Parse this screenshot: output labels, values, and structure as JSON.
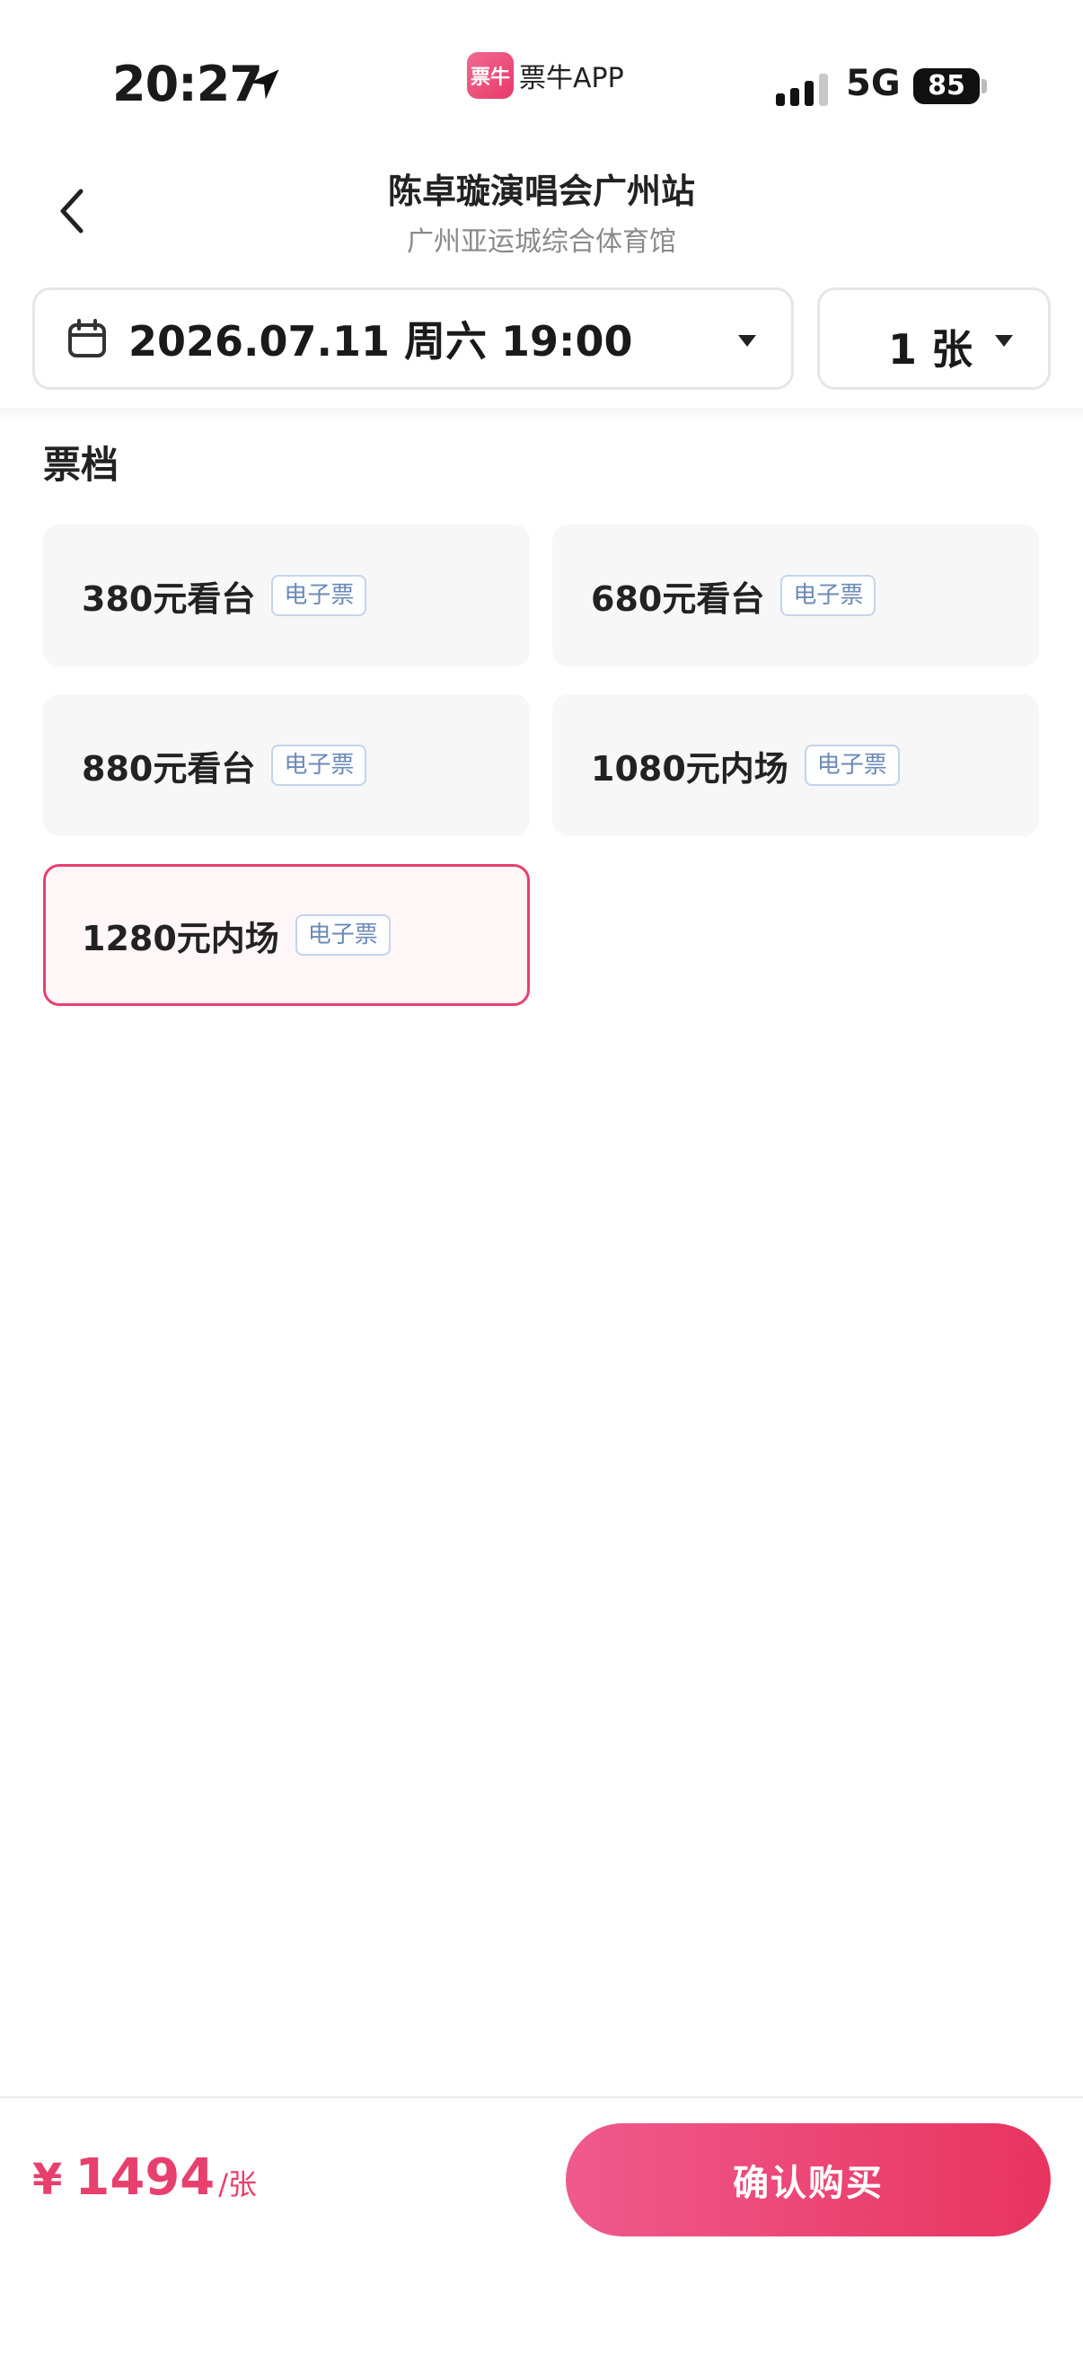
{
  "status_bar": {
    "time": "20:27",
    "app_name": "票牛APP",
    "app_logo_text": "票牛",
    "network": "5G",
    "battery": "85"
  },
  "header": {
    "title": "陈卓璇演唱会广州站",
    "subtitle": "广州亚运城综合体育馆"
  },
  "date_selector": {
    "value": "2026.07.11 周六 19:00"
  },
  "quantity_selector": {
    "value": "1 张"
  },
  "section": {
    "title": "票档"
  },
  "tiers": [
    {
      "label": "380元看台",
      "tag": "电子票",
      "selected": false
    },
    {
      "label": "680元看台",
      "tag": "电子票",
      "selected": false
    },
    {
      "label": "880元看台",
      "tag": "电子票",
      "selected": false
    },
    {
      "label": "1080元内场",
      "tag": "电子票",
      "selected": false
    },
    {
      "label": "1280元内场",
      "tag": "电子票",
      "selected": true
    }
  ],
  "bottom_bar": {
    "currency": "¥",
    "price": "1494",
    "unit": "/张",
    "buy_label": "确认购买"
  },
  "colors": {
    "accent": "#e8406e",
    "tag_text": "#6b8ab8",
    "tag_border": "#c5d4ea",
    "tier_bg": "#f7f7f7"
  }
}
